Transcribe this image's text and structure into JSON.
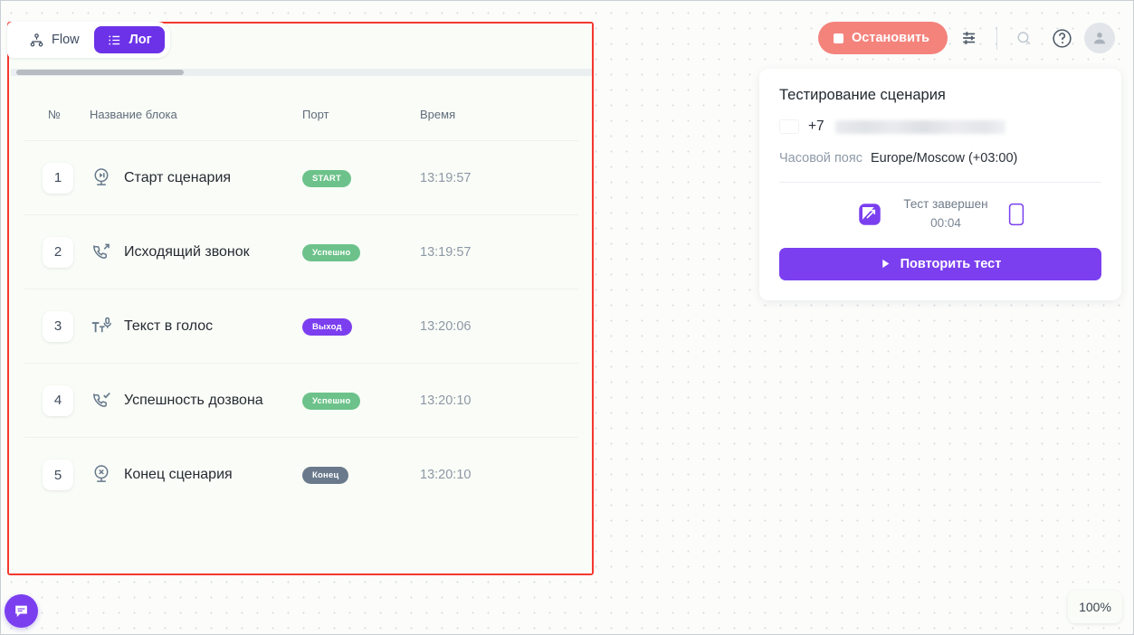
{
  "tabs": [
    {
      "label": "Flow",
      "icon": "flow-icon",
      "active": false
    },
    {
      "label": "Лог",
      "icon": "list-icon",
      "active": true
    }
  ],
  "toolbar": {
    "stop_label": "Остановить",
    "stop_color": "#f4837c",
    "icons": [
      "settings-sliders-icon",
      "search-icon",
      "help-circle-icon",
      "user-avatar-icon"
    ]
  },
  "log_table": {
    "columns": {
      "num": "№",
      "name": "Название блока",
      "port": "Порт",
      "time": "Время"
    },
    "rows": [
      {
        "num": "1",
        "icon": "start-scenario-icon",
        "name": "Старт сценария",
        "port": "START",
        "port_style": "green",
        "time": "13:19:57"
      },
      {
        "num": "2",
        "icon": "outgoing-call-icon",
        "name": "Исходящий звонок",
        "port": "Успешно",
        "port_style": "green",
        "time": "13:19:57"
      },
      {
        "num": "3",
        "icon": "text-to-speech-icon",
        "name": "Текст в голос",
        "port": "Выход",
        "port_style": "purple",
        "time": "13:20:06"
      },
      {
        "num": "4",
        "icon": "call-success-icon",
        "name": "Успешность дозвона",
        "port": "Успешно",
        "port_style": "green",
        "time": "13:20:10"
      },
      {
        "num": "5",
        "icon": "end-scenario-icon",
        "name": "Конец сценария",
        "port": "Конец",
        "port_style": "slate",
        "time": "13:20:10"
      }
    ]
  },
  "info_card": {
    "title": "Тестирование сценария",
    "flag": "ru-flag-icon",
    "phone_prefix": "+7",
    "phone_masked": true,
    "timezone_label": "Часовой пояс",
    "timezone_value": "Europe/Moscow (+03:00)",
    "status_title": "Тест завершен",
    "status_time": "00:04",
    "device_icon": "call-window-icon",
    "phone_icon": "mobile-phone-icon",
    "repeat_label": "Повторить тест"
  },
  "floating": {
    "chat_icon": "chat-bubble-icon",
    "zoom_level": "100%"
  },
  "colors": {
    "accent_purple": "#7b3fef",
    "tab_active": "#6b32e8",
    "stop_red": "#f4837c",
    "badge_green": "#6cc28a",
    "badge_slate": "#6a7a8c",
    "highlight_border": "#f4382f"
  }
}
